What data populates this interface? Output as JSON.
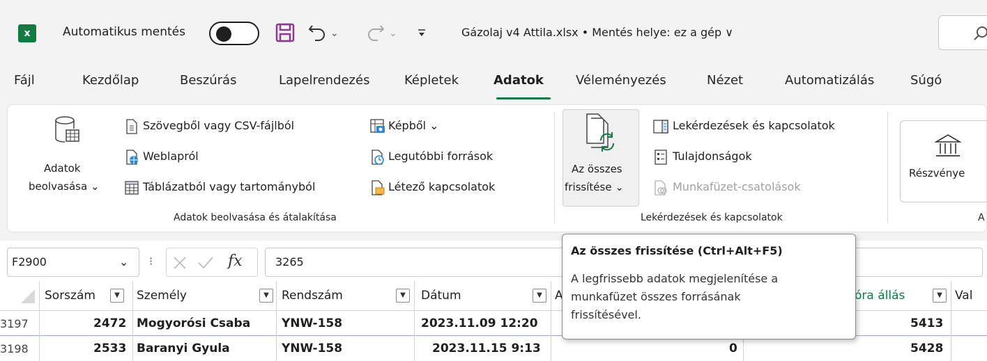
{
  "titlebar": {
    "app_icon": "x",
    "autosave_label": "Automatikus mentés",
    "file_title": "Gázolaj v4 Attila.xlsx • Mentés helye: ez a gép ∨"
  },
  "tabs": [
    "Fájl",
    "Kezdőlap",
    "Beszúrás",
    "Lapelrendezés",
    "Képletek",
    "Adatok",
    "Véleményezés",
    "Nézet",
    "Automatizálás",
    "Súgó"
  ],
  "ribbon": {
    "get_data": {
      "line1": "Adatok",
      "line2": "beolvasása ⌄"
    },
    "from_text_csv": "Szövegből vagy CSV-fájlból",
    "from_web": "Weblapról",
    "from_table": "Táblázatból vagy tartományból",
    "from_picture": "Képből ⌄",
    "recent_sources": "Legutóbbi források",
    "existing_connections": "Létező kapcsolatok",
    "group1_label": "Adatok beolvasása és átalakítása",
    "refresh_all": {
      "line1": "Az összes",
      "line2": "frissítése ⌄"
    },
    "queries_connections": "Lekérdezések és kapcsolatok",
    "properties": "Tulajdonságok",
    "workbook_links": "Munkafüzet-csatolások",
    "group2_label": "Lekérdezések és kapcsolatok",
    "stocks": "Részvénye",
    "group3_label": "A"
  },
  "formula_bar": {
    "name_box": "F2900",
    "fx": "fx",
    "value": "3265"
  },
  "grid": {
    "headers": [
      "Sorszám",
      "Személy",
      "Rendszám",
      "Dátum",
      "A",
      "óra állás",
      "Val"
    ],
    "rows": [
      {
        "row_num": "3197",
        "sorszam": "2472",
        "szemely": "Mogyorósi Csaba",
        "rendszam": "YNW-158",
        "datum": "2023.11.09 12:20",
        "e": "",
        "ora": "5413"
      },
      {
        "row_num": "3198",
        "sorszam": "2533",
        "szemely": "Baranyi Gyula",
        "rendszam": "YNW-158",
        "datum": "2023.11.15 9:13",
        "e": "0",
        "ora": "5428"
      }
    ]
  },
  "tooltip": {
    "title": "Az összes frissítése (Ctrl+Alt+F5)",
    "line1": "A legfrissebb adatok megjelenítése a",
    "line2": "munkafüzet összes forrásának",
    "line3": "frissítésével."
  },
  "colors": {
    "excel_green": "#107c41",
    "save_purple": "#8b3a8f"
  }
}
